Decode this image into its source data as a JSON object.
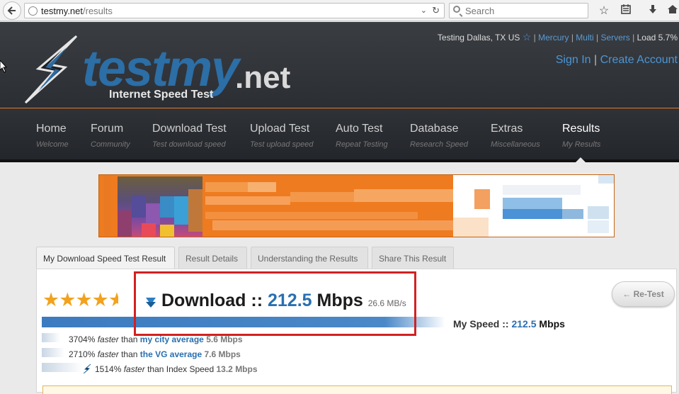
{
  "browser": {
    "url_domain": "testmy.net",
    "url_path": "/results",
    "search_placeholder": "Search"
  },
  "header": {
    "testing_location": "Testing Dallas, TX US",
    "links": [
      "Mercury",
      "Multi",
      "Servers"
    ],
    "load": "Load 5.7%",
    "sign_in": "Sign In",
    "create_account": "Create Account",
    "logo_main": "testmy",
    "logo_net": ".net",
    "tagline": "Internet Speed Test"
  },
  "nav": [
    {
      "label": "Home",
      "sub": "Welcome"
    },
    {
      "label": "Forum",
      "sub": "Community"
    },
    {
      "label": "Download Test",
      "sub": "Test download speed"
    },
    {
      "label": "Upload Test",
      "sub": "Test upload speed"
    },
    {
      "label": "Auto Test",
      "sub": "Repeat Testing"
    },
    {
      "label": "Database",
      "sub": "Research Speed"
    },
    {
      "label": "Extras",
      "sub": "Miscellaneous"
    },
    {
      "label": "Results",
      "sub": "My Results"
    }
  ],
  "tabs": [
    {
      "label": "My Download Speed Test Result"
    },
    {
      "label": "Result Details"
    },
    {
      "label": "Understanding the Results"
    },
    {
      "label": "Share This Result"
    }
  ],
  "result": {
    "rating_stars": 4.5,
    "title_prefix": "Download ::",
    "speed": "212.5",
    "unit": "Mbps",
    "mb_per_sec": "26.6 MB/s",
    "retest_label": "← Re-Test",
    "my_speed_label": "My Speed ::",
    "my_speed_value": "212.5",
    "my_speed_unit": "Mbps",
    "comparisons": [
      {
        "pct": "3704%",
        "faster": "faster",
        "than": "than",
        "ref": "my city average",
        "value": "5.6 Mbps"
      },
      {
        "pct": "2710%",
        "faster": "faster",
        "than": "than",
        "ref": "the VG average",
        "value": "7.6 Mbps"
      },
      {
        "pct": "1514%",
        "faster": "faster",
        "than": "than Index Speed",
        "ref": "",
        "value": "13.2 Mbps"
      }
    ]
  },
  "colors": {
    "accent_blue": "#2a6fb0",
    "highlight_red": "#d22121",
    "banner_orange": "#ee7b1f",
    "star_gold": "#f2a21e"
  }
}
